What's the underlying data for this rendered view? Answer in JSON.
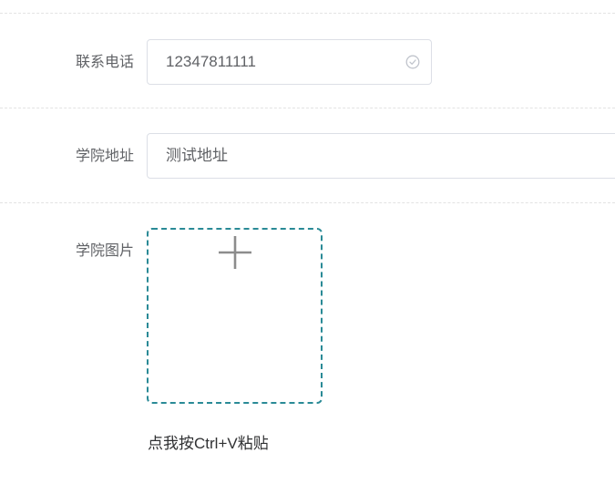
{
  "form": {
    "phone": {
      "label": "联系电话",
      "value": "12347811111",
      "status_icon": "check-circle-icon"
    },
    "address": {
      "label": "学院地址",
      "value": "测试地址"
    },
    "image": {
      "label": "学院图片",
      "upload_icon": "plus-icon",
      "paste_hint": "点我按Ctrl+V粘贴"
    }
  },
  "colors": {
    "label_text": "#606266",
    "input_border": "#dcdfe6",
    "upload_border": "#2a8a96",
    "icon_gray": "#8c8c8c",
    "check_icon": "#c0c4cc"
  }
}
